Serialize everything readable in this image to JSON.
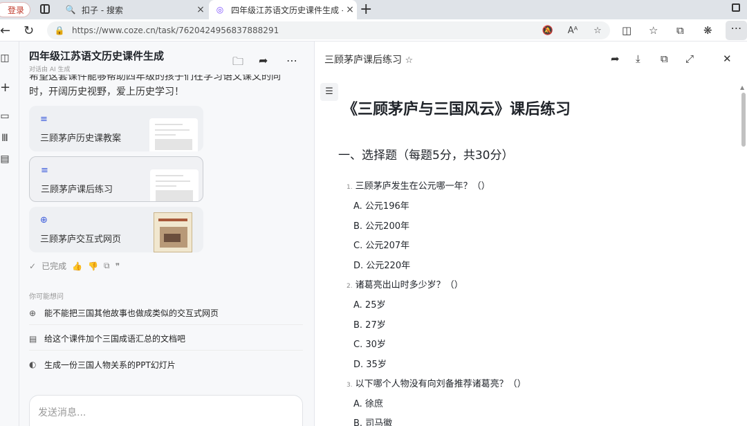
{
  "browser": {
    "login_label": "登录",
    "tabs": [
      {
        "icon": "search-icon",
        "glyph": "🔍",
        "title": "扣子 - 搜索",
        "close": "×"
      },
      {
        "icon": "coze-icon",
        "glyph": "◎",
        "title": "四年级江苏语文历史课件生成 - 扣",
        "close": "×"
      }
    ],
    "new_tab": "+",
    "url": "https://www.coze.cn/task/7620424956837888291",
    "more": "⋯"
  },
  "chat": {
    "title": "四年级江苏语文历史课件生成",
    "subtitle": "对话由 AI 生成",
    "intro": "希望这套课件能够帮助四年级的孩子们在学习语文课文的同时，开阔历史视野，爱上历史学习！",
    "cards": [
      {
        "icon": "document-icon",
        "glyph": "≡",
        "label": "三顾茅庐历史课教案"
      },
      {
        "icon": "document-icon",
        "glyph": "≡",
        "label": "三顾茅庐课后练习"
      },
      {
        "icon": "globe-icon",
        "glyph": "⊕",
        "label": "三顾茅庐交互式网页"
      }
    ],
    "status": "已完成",
    "suggest_label": "你可能想问",
    "suggestions": [
      {
        "icon": "globe-icon",
        "glyph": "⊕",
        "text": "能不能把三国其他故事也做成类似的交互式网页"
      },
      {
        "icon": "document-icon",
        "glyph": "▤",
        "text": "给这个课件加个三国成语汇总的文档吧"
      },
      {
        "icon": "slides-icon",
        "glyph": "◐",
        "text": "生成一份三国人物关系的PPT幻灯片"
      }
    ],
    "input_placeholder": "发送消息..."
  },
  "document": {
    "header_title": "三顾茅庐课后练习",
    "title": "《三顾茅庐与三国风云》课后练习",
    "section": "一、选择题（每题5分，共30分）",
    "questions": [
      {
        "num": "1.",
        "text": "三顾茅庐发生在公元哪一年？（）",
        "options": [
          "A. 公元196年",
          "B. 公元200年",
          "C. 公元207年",
          "D. 公元220年"
        ]
      },
      {
        "num": "2.",
        "text": "诸葛亮出山时多少岁？（）",
        "options": [
          "A. 25岁",
          "B. 27岁",
          "C. 30岁",
          "D. 35岁"
        ]
      },
      {
        "num": "3.",
        "text": "以下哪个人物没有向刘备推荐诸葛亮？（）",
        "options": [
          "A. 徐庶",
          "B. 司马徽"
        ]
      }
    ]
  }
}
